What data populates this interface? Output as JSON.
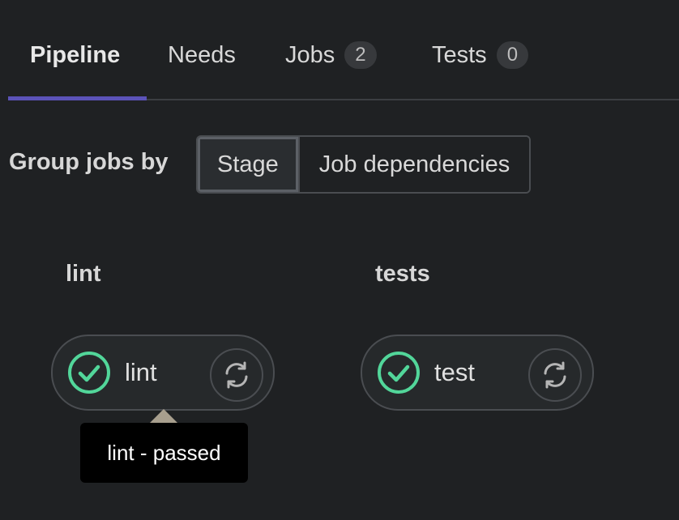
{
  "tabs": [
    {
      "label": "Pipeline",
      "active": true
    },
    {
      "label": "Needs"
    },
    {
      "label": "Jobs",
      "count": "2"
    },
    {
      "label": "Tests",
      "count": "0"
    }
  ],
  "group_by": {
    "label": "Group jobs by",
    "options": [
      "Stage",
      "Job dependencies"
    ],
    "selected": "Stage"
  },
  "stages": [
    {
      "title": "lint",
      "job": {
        "name": "lint",
        "status": "passed",
        "status_icon": "check-circle-icon",
        "action_icon": "retry-icon"
      }
    },
    {
      "title": "tests",
      "job": {
        "name": "test",
        "status": "passed",
        "status_icon": "check-circle-icon",
        "action_icon": "retry-icon"
      }
    }
  ],
  "tooltip": {
    "text": "lint - passed"
  },
  "colors": {
    "accent": "#5b53b8",
    "success": "#52d69a",
    "background": "#1f2123"
  }
}
